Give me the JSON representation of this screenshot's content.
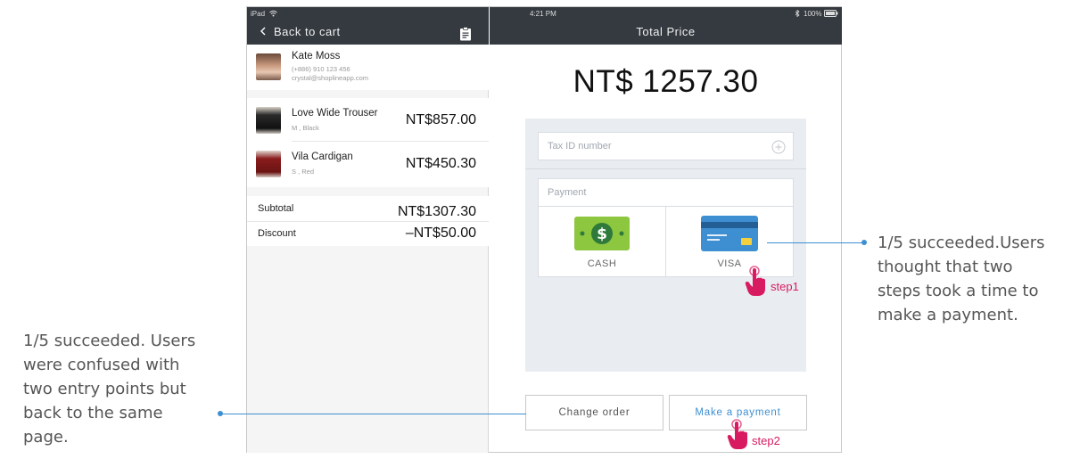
{
  "status_bar": {
    "device": "iPad",
    "time": "4:21 PM",
    "battery": "100%"
  },
  "left_header": {
    "back_label": "Back to cart",
    "clipboard_icon": "clipboard-icon"
  },
  "customer": {
    "name": "Kate Moss",
    "phone": "(+886) 910 123 456",
    "email": "crystal@shoplineapp.com"
  },
  "items": [
    {
      "name": "Love Wide Trouser",
      "variant": "M , Black",
      "price": "NT$857.00"
    },
    {
      "name": "Vila Cardigan",
      "variant": "S , Red",
      "price": "NT$450.30"
    }
  ],
  "summary": {
    "subtotal_label": "Subtotal",
    "subtotal_value": "NT$1307.30",
    "discount_label": "Discount",
    "discount_value": "–NT$50.00"
  },
  "right_header": {
    "title": "Total Price"
  },
  "total": "NT$ 1257.30",
  "tax_field": {
    "placeholder": "Tax ID number"
  },
  "payment": {
    "label": "Payment",
    "options": [
      {
        "label": "CASH",
        "icon": "cash-icon"
      },
      {
        "label": "VISA",
        "icon": "credit-card-icon"
      }
    ]
  },
  "buttons": {
    "change_order": "Change order",
    "make_payment": "Make a payment"
  },
  "steps": {
    "step1": "step1",
    "step2": "step2"
  },
  "annotations": {
    "right": [
      "1/5 succeeded.Users",
      "thought that two",
      "steps took a time to",
      "make a payment."
    ],
    "left": [
      "1/5 succeeded. Users",
      "were confused with",
      "two entry points but",
      "back to the same",
      "page."
    ]
  },
  "colors": {
    "header": "#343a40",
    "accent": "#3d8fd1",
    "step": "#d81b60",
    "cash_green": "#8dc63f",
    "card_blue": "#3d8fd1"
  }
}
